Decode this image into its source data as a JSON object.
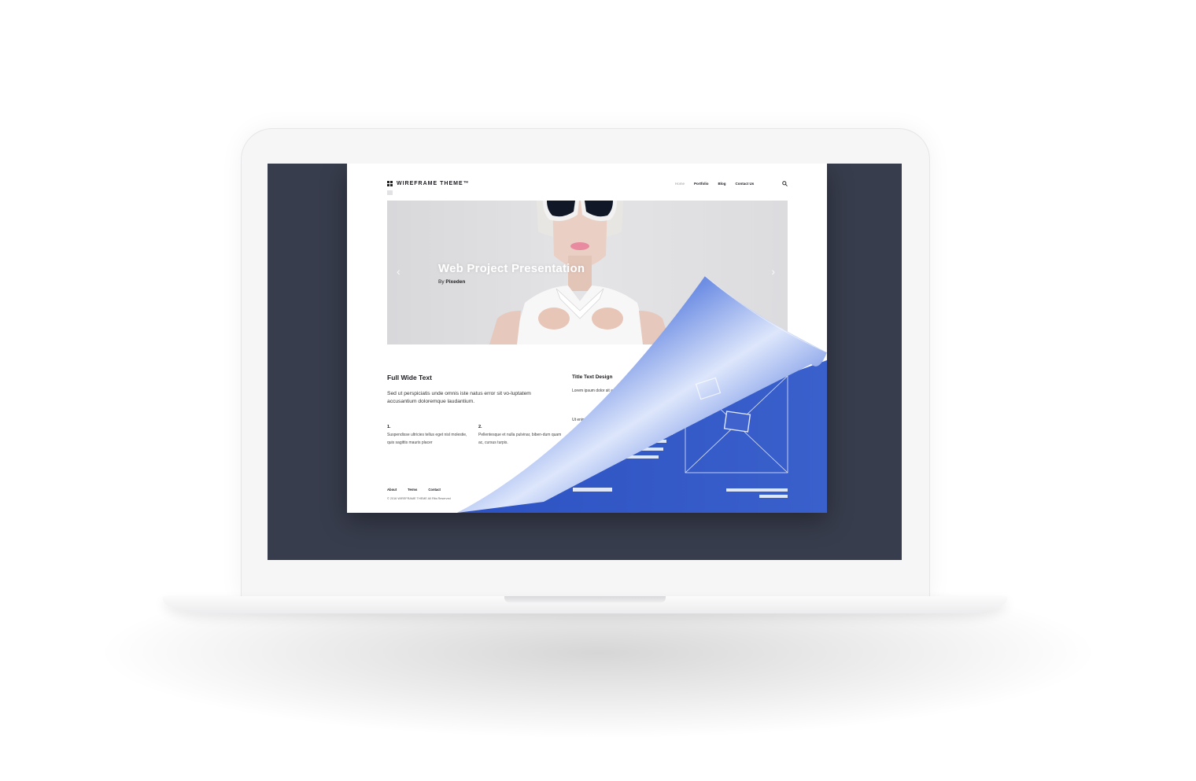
{
  "theme": {
    "screen_bg": "#383d4d",
    "accent_blue": "#3458c4"
  },
  "site": {
    "logo_text": "WIREFRAME THEME™",
    "nav": [
      {
        "label": "Home",
        "active": true
      },
      {
        "label": "Portfolio",
        "active": false
      },
      {
        "label": "Blog",
        "active": false
      },
      {
        "label": "Contact Us",
        "active": false
      }
    ],
    "search_icon": "search-icon"
  },
  "hero": {
    "title": "Web Project Presentation",
    "by_prefix": "By",
    "by_author": "Pixeden",
    "prev_icon": "chevron-left-icon",
    "next_icon": "chevron-right-icon"
  },
  "content": {
    "full_title": "Full Wide Text",
    "full_body": "Sed ut perspiciatis unde omnis iste natus error sit vo-luptatem accusantium doloremque laudantium.",
    "col1_num": "1.",
    "col1_text": "Suspendisse ultricies tellus eget nisl molestie, quis sagittis mauris placer",
    "col2_num": "2.",
    "col2_text": "Pellentesque et nulla pulvinar, biben-dum quam ac, cursus turpis.",
    "title_design": "Title Text Design",
    "lorem_1": "Lorem ipsum dolor sit amet, consectetur adipiscing elit, sed do eiusmod tempor ut labore et",
    "lorem_2": "Ut enim ad minim veniam, tate"
  },
  "footer": {
    "links": [
      "About",
      "Terms",
      "Contact"
    ],
    "copyright": "© 2016 WIREFRAME THEME All Rits Reserved"
  }
}
